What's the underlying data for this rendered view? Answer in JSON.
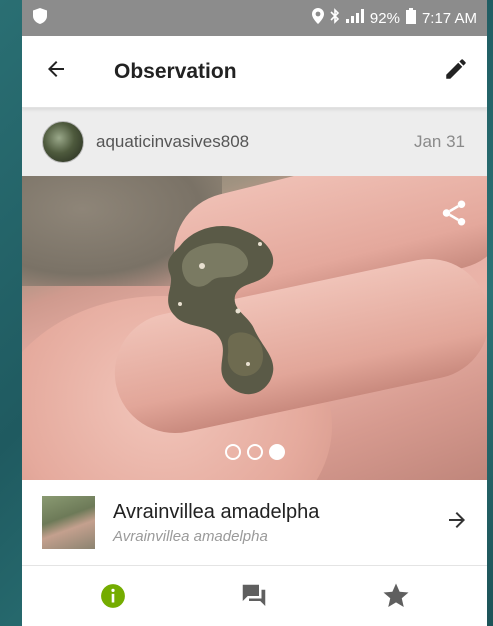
{
  "status_bar": {
    "battery_percent": "92%",
    "time": "7:17 AM",
    "icons": [
      "shield-icon",
      "location-icon",
      "bluetooth-icon",
      "signal-icon",
      "battery-icon"
    ]
  },
  "app_bar": {
    "title": "Observation",
    "back_icon": "arrow-back-icon",
    "edit_icon": "pencil-icon"
  },
  "observation": {
    "username": "aquaticinvasives808",
    "date": "Jan 31",
    "photo_count": 3,
    "active_photo_index": 2
  },
  "taxon": {
    "name": "Avrainvillea amadelpha",
    "scientific_name": "Avrainvillea amadelpha"
  },
  "tabs": [
    {
      "icon": "info-icon",
      "active": true
    },
    {
      "icon": "chat-icon",
      "active": false
    },
    {
      "icon": "star-icon",
      "active": false
    }
  ],
  "colors": {
    "accent_green": "#74ac00",
    "tab_inactive": "#757575",
    "status_bar": "#8c8c8c"
  }
}
